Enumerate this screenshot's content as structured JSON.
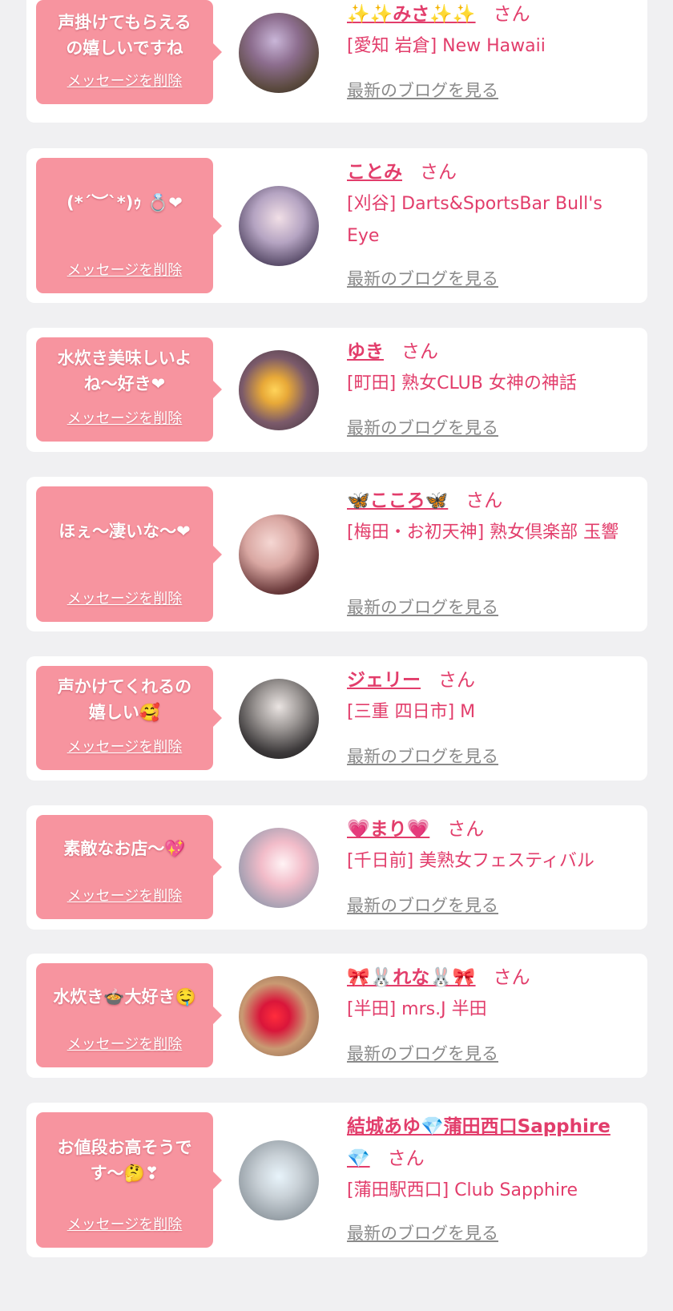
{
  "colors": {
    "page_background": "#f0f0f2",
    "card_background": "#ffffff",
    "bubble_background": "#f7949f",
    "name_color": "#e23d6b",
    "shop_color": "#e23d6b",
    "blog_link_color": "#8a8a8a"
  },
  "messages": [
    {
      "bubble_lines": [
        "声掛けてもらえる",
        "の嬉しいですね"
      ],
      "delete_label": "メッセージを削除",
      "avatar_icon": "profile-photo",
      "name_lines": [
        "✨✨みさ✨✨"
      ],
      "suffix": "さん",
      "shop": "[愛知 岩倉] New Hawaii",
      "blog_label": "最新のブログを見る"
    },
    {
      "bubble_lines": [
        "(*´︶`*)ｩ 💍❤"
      ],
      "delete_label": "メッセージを削除",
      "avatar_icon": "profile-photo",
      "name_lines": [
        "ことみ"
      ],
      "suffix": "さん",
      "shop": "[刈谷] Darts&SportsBar Bull's Eye",
      "blog_label": "最新のブログを見る"
    },
    {
      "bubble_lines": [
        "水炊き美味しいよ",
        "ね〜好き❤"
      ],
      "delete_label": "メッセージを削除",
      "avatar_icon": "profile-photo",
      "name_lines": [
        "ゆき"
      ],
      "suffix": "さん",
      "shop": "[町田] 熟女CLUB 女神の神話",
      "blog_label": "最新のブログを見る"
    },
    {
      "bubble_lines": [
        "ほぇ〜凄いな〜❤"
      ],
      "delete_label": "メッセージを削除",
      "avatar_icon": "profile-photo",
      "name_lines": [
        "🦋こころ🦋"
      ],
      "suffix": "さん",
      "shop": "[梅田・お初天神] 熟女倶楽部 玉響",
      "blog_label": "最新のブログを見る"
    },
    {
      "bubble_lines": [
        "声かけてくれるの",
        "嬉しい🥰"
      ],
      "delete_label": "メッセージを削除",
      "avatar_icon": "profile-photo",
      "name_lines": [
        "ジェリー"
      ],
      "suffix": "さん",
      "shop": "[三重 四日市] M",
      "blog_label": "最新のブログを見る"
    },
    {
      "bubble_lines": [
        "素敵なお店〜💖"
      ],
      "delete_label": "メッセージを削除",
      "avatar_icon": "profile-photo",
      "name_lines": [
        "💗まり💗"
      ],
      "suffix": "さん",
      "shop": "[千日前] 美熟女フェスティバル",
      "blog_label": "最新のブログを見る"
    },
    {
      "bubble_lines": [
        "水炊き🍲大好き🤤"
      ],
      "delete_label": "メッセージを削除",
      "avatar_icon": "profile-photo",
      "name_lines": [
        "🎀🐰れな🐰🎀"
      ],
      "suffix": "さん",
      "shop": "[半田] mrs.J 半田",
      "blog_label": "最新のブログを見る"
    },
    {
      "bubble_lines": [
        "お値段お高そうで",
        "す〜🤔❣"
      ],
      "delete_label": "メッセージを削除",
      "avatar_icon": "profile-photo",
      "name_lines": [
        "結城あゆ💎蒲田西口Sapphire",
        "💎"
      ],
      "suffix": "さん",
      "shop": "[蒲田駅西口] Club Sapphire",
      "blog_label": "最新のブログを見る"
    }
  ]
}
